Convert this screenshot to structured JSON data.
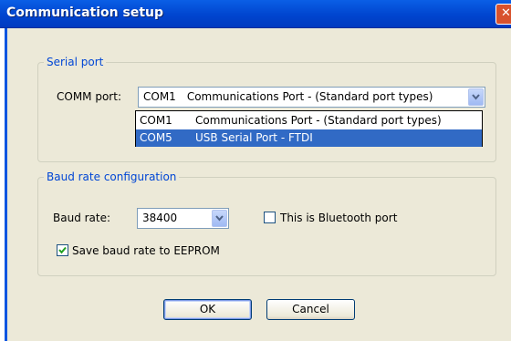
{
  "window": {
    "title": "Communication setup"
  },
  "serial_port": {
    "legend": "Serial port",
    "comm_label": "COMM port:",
    "selected": {
      "port": "COM1",
      "description": "Communications Port - (Standard port types)"
    },
    "options": [
      {
        "port": "COM1",
        "description": "Communications Port - (Standard port types)",
        "highlighted": false
      },
      {
        "port": "COM5",
        "description": "USB Serial Port - FTDI",
        "highlighted": true
      }
    ]
  },
  "baud_config": {
    "legend": "Baud rate configuration",
    "baud_label": "Baud rate:",
    "baud_value": "38400",
    "bluetooth_label": "This is Bluetooth port",
    "bluetooth_checked": false,
    "save_label": "Save baud rate to EEPROM",
    "save_checked": true
  },
  "buttons": {
    "ok": "OK",
    "cancel": "Cancel"
  },
  "colors": {
    "titlebar": "#0045cf",
    "dialog_bg": "#ece9d8",
    "legend_text": "#0046d5",
    "selection": "#316ac5"
  }
}
